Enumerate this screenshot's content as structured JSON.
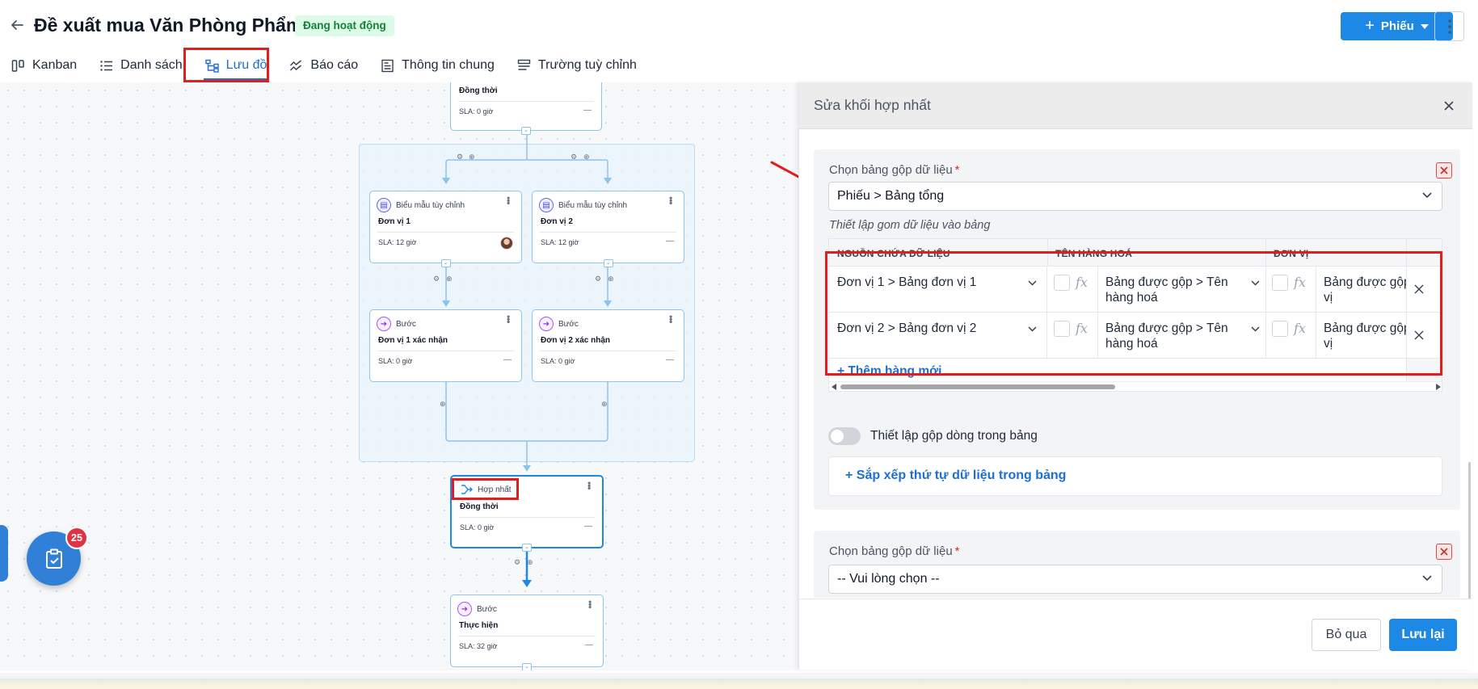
{
  "header": {
    "title": "Đề xuất mua Văn Phòng Phẩm",
    "status": "Đang hoạt động",
    "create_button": "Phiếu",
    "colors": {
      "accent": "#1e88e5",
      "status_bg": "#dcfce7",
      "status_fg": "#15803d",
      "highlight": "#e11d1d"
    }
  },
  "tabs": [
    {
      "label": "Kanban",
      "icon": "kanban-icon"
    },
    {
      "label": "Danh sách",
      "icon": "list-icon"
    },
    {
      "label": "Lưu đồ",
      "icon": "flowchart-icon",
      "active": true
    },
    {
      "label": "Báo cáo",
      "icon": "report-icon"
    },
    {
      "label": "Thông tin chung",
      "icon": "info-icon"
    },
    {
      "label": "Trường tuỳ chỉnh",
      "icon": "custom-fields-icon"
    }
  ],
  "flow": {
    "top_node": {
      "title": "Đồng thời",
      "sla": "SLA: 0 giờ",
      "dash": "—"
    },
    "form_nodes": [
      {
        "type": "Biểu mẫu tùy chỉnh",
        "title": "Đơn vị 1",
        "sla": "SLA: 12 giờ",
        "has_avatar": true
      },
      {
        "type": "Biểu mẫu tùy chỉnh",
        "title": "Đơn vị 2",
        "sla": "SLA: 12 giờ",
        "dash": "—"
      }
    ],
    "step_nodes": [
      {
        "type": "Bước",
        "title": "Đơn vị 1 xác nhận",
        "sla": "SLA: 0 giờ",
        "dash": "—"
      },
      {
        "type": "Bước",
        "title": "Đơn vị 2 xác nhận",
        "sla": "SLA: 0 giờ",
        "dash": "—"
      }
    ],
    "merge_node": {
      "type": "Hợp nhất",
      "title": "Đồng thời",
      "sla": "SLA: 0 giờ",
      "dash": "—"
    },
    "exec_node": {
      "type": "Bước",
      "title": "Thực hiện",
      "sla": "SLA: 32 giờ",
      "dash": "—"
    }
  },
  "fab": {
    "badge": "25",
    "icon": "clipboard-check-icon"
  },
  "panel": {
    "title": "Sửa khối hợp nhất",
    "section1": {
      "label": "Chọn bảng gộp dữ liệu",
      "required_mark": "*",
      "selected": "Phiếu > Bảng tổng",
      "sub_label": "Thiết lập gom dữ liệu vào bảng",
      "columns": [
        "NGUỒN CHỨA DỮ LIỆU",
        "TÊN HÀNG HOÁ",
        "ĐƠN VỊ"
      ],
      "fx_label": "fx",
      "rows": [
        {
          "source": "Đơn vị 1 > Bảng đơn vị 1",
          "name_line1": "Bảng được gộp > Tên",
          "name_line2": "hàng hoá",
          "unit_line1": "Bảng được gộp",
          "unit_line2": "vị"
        },
        {
          "source": "Đơn vị 2 > Bảng đơn vị 2",
          "name_line1": "Bảng được gộp > Tên",
          "name_line2": "hàng hoá",
          "unit_line1": "Bảng được gộp",
          "unit_line2": "vị"
        }
      ],
      "add_row": "+ Thêm hàng mới",
      "toggle_label": "Thiết lập gộp dòng trong bảng",
      "toggle_on": false,
      "sort_link": "+ Sắp xếp thứ tự dữ liệu trong bảng"
    },
    "section2": {
      "label": "Chọn bảng gộp dữ liệu",
      "required_mark": "*",
      "placeholder": "-- Vui lòng chọn --"
    },
    "buttons": {
      "skip": "Bỏ qua",
      "save": "Lưu lại"
    }
  }
}
